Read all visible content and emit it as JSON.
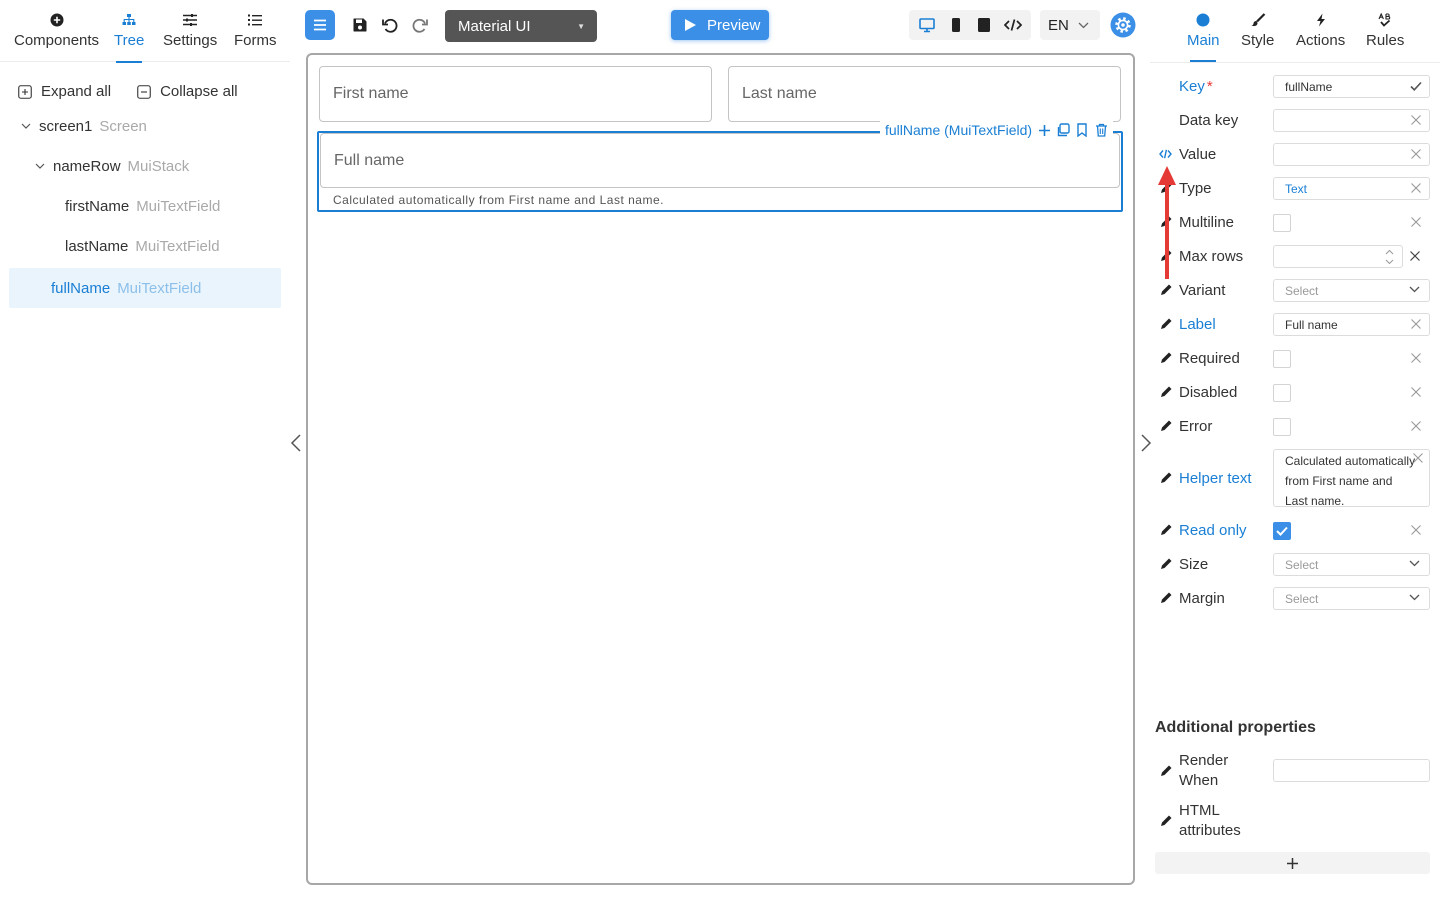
{
  "left_panel": {
    "tabs": [
      {
        "label": "Components",
        "icon": "plus-circle-icon"
      },
      {
        "label": "Tree",
        "icon": "hierarchy-icon"
      },
      {
        "label": "Settings",
        "icon": "sliders-icon"
      },
      {
        "label": "Forms",
        "icon": "list-icon"
      }
    ],
    "active_tab": "Tree",
    "expand_all": "Expand all",
    "collapse_all": "Collapse all",
    "tree": [
      {
        "name": "screen1",
        "type": "Screen"
      },
      {
        "name": "nameRow",
        "type": "MuiStack"
      },
      {
        "name": "firstName",
        "type": "MuiTextField"
      },
      {
        "name": "lastName",
        "type": "MuiTextField"
      },
      {
        "name": "fullName",
        "type": "MuiTextField",
        "selected": true
      }
    ]
  },
  "toolbar": {
    "theme_select": "Material UI",
    "preview_label": "Preview",
    "language": "EN"
  },
  "canvas": {
    "first_name_label": "First name",
    "last_name_label": "Last name",
    "full_name_label": "Full name",
    "helper_text": "Calculated automatically from First name and Last name.",
    "selected_component": "fullName (MuiTextField)"
  },
  "right_panel": {
    "tabs": [
      {
        "label": "Main",
        "icon": "circle-icon"
      },
      {
        "label": "Style",
        "icon": "brush-icon"
      },
      {
        "label": "Actions",
        "icon": "lightning-icon"
      },
      {
        "label": "Rules",
        "icon": "rules-icon"
      }
    ],
    "active_tab": "Main",
    "props": {
      "key": {
        "label": "Key",
        "value": "fullName"
      },
      "data_key": {
        "label": "Data key",
        "value": ""
      },
      "value": {
        "label": "Value",
        "value": ""
      },
      "type": {
        "label": "Type",
        "value": "Text"
      },
      "multiline": {
        "label": "Multiline",
        "checked": false
      },
      "max_rows": {
        "label": "Max rows",
        "value": ""
      },
      "variant": {
        "label": "Variant",
        "placeholder": "Select"
      },
      "label": {
        "label": "Label",
        "value": "Full name"
      },
      "required": {
        "label": "Required",
        "checked": false
      },
      "disabled": {
        "label": "Disabled",
        "checked": false
      },
      "error": {
        "label": "Error",
        "checked": false
      },
      "helper_text": {
        "label": "Helper text",
        "value": "Calculated automatically from First name and Last name."
      },
      "read_only": {
        "label": "Read only",
        "checked": true
      },
      "size": {
        "label": "Size",
        "placeholder": "Select"
      },
      "margin": {
        "label": "Margin",
        "placeholder": "Select"
      }
    },
    "additional_title": "Additional properties",
    "render_when": {
      "label": "Render When",
      "value": ""
    },
    "html_attributes": {
      "label": "HTML attributes"
    }
  },
  "colors": {
    "accent": "#1a7fd4",
    "button": "#3b8fe6",
    "annotation": "#e53935"
  }
}
